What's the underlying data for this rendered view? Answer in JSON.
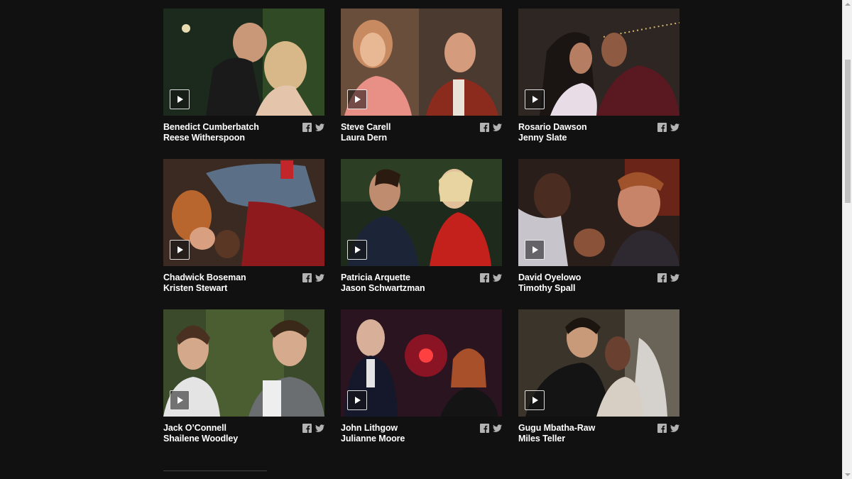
{
  "cards": [
    {
      "names": [
        "Benedict Cumberbatch",
        "Reese Witherspoon"
      ]
    },
    {
      "names": [
        "Steve Carell",
        "Laura Dern"
      ]
    },
    {
      "names": [
        "Rosario Dawson",
        "Jenny Slate"
      ]
    },
    {
      "names": [
        "Chadwick Boseman",
        "Kristen Stewart"
      ]
    },
    {
      "names": [
        "Patricia Arquette",
        "Jason Schwartzman"
      ]
    },
    {
      "names": [
        "David Oyelowo",
        "Timothy Spall"
      ]
    },
    {
      "names": [
        "Jack O’Connell",
        "Shailene Woodley"
      ]
    },
    {
      "names": [
        "John Lithgow",
        "Julianne Moore"
      ]
    },
    {
      "names": [
        "Gugu Mbatha-Raw",
        "Miles Teller"
      ]
    }
  ],
  "icons": {
    "play": "play-icon",
    "facebook": "facebook-icon",
    "twitter": "twitter-icon"
  },
  "colors": {
    "background": "#111111",
    "text": "#ffffff",
    "icon": "#b3b3b3"
  }
}
